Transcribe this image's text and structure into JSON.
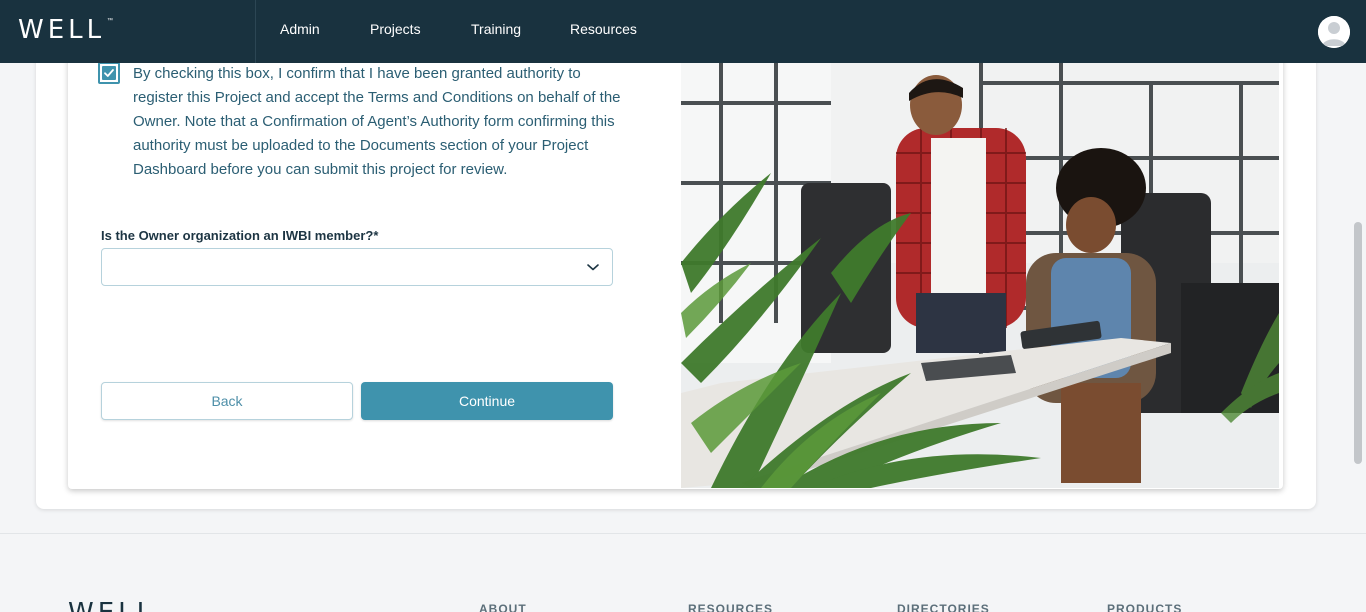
{
  "header": {
    "logo": "WELL",
    "logo_tm": "™",
    "nav": [
      "Admin",
      "Projects",
      "Training",
      "Resources"
    ],
    "avatar_icon": "user-avatar-icon"
  },
  "form": {
    "checkbox_checked": true,
    "confirm_text": "By checking this box, I confirm that I have been granted authority to register this Project and accept the Terms and Conditions on behalf of the Owner. Note that a Confirmation of Agent’s Authority form confirming this authority must be uploaded to the Documents section of your Project Dashboard before you can submit this project for review.",
    "iwbi_question": "Is the Owner organization an IWBI member?*",
    "iwbi_selected": "",
    "back_label": "Back",
    "continue_label": "Continue"
  },
  "footer": {
    "logo": "WELL",
    "columns": [
      "ABOUT",
      "RESOURCES",
      "DIRECTORIES",
      "PRODUCTS"
    ]
  },
  "colors": {
    "nav_bg": "#19323f",
    "accent": "#3f93ad",
    "text_link": "#2b5e73",
    "page_bg": "#f4f5f7"
  }
}
